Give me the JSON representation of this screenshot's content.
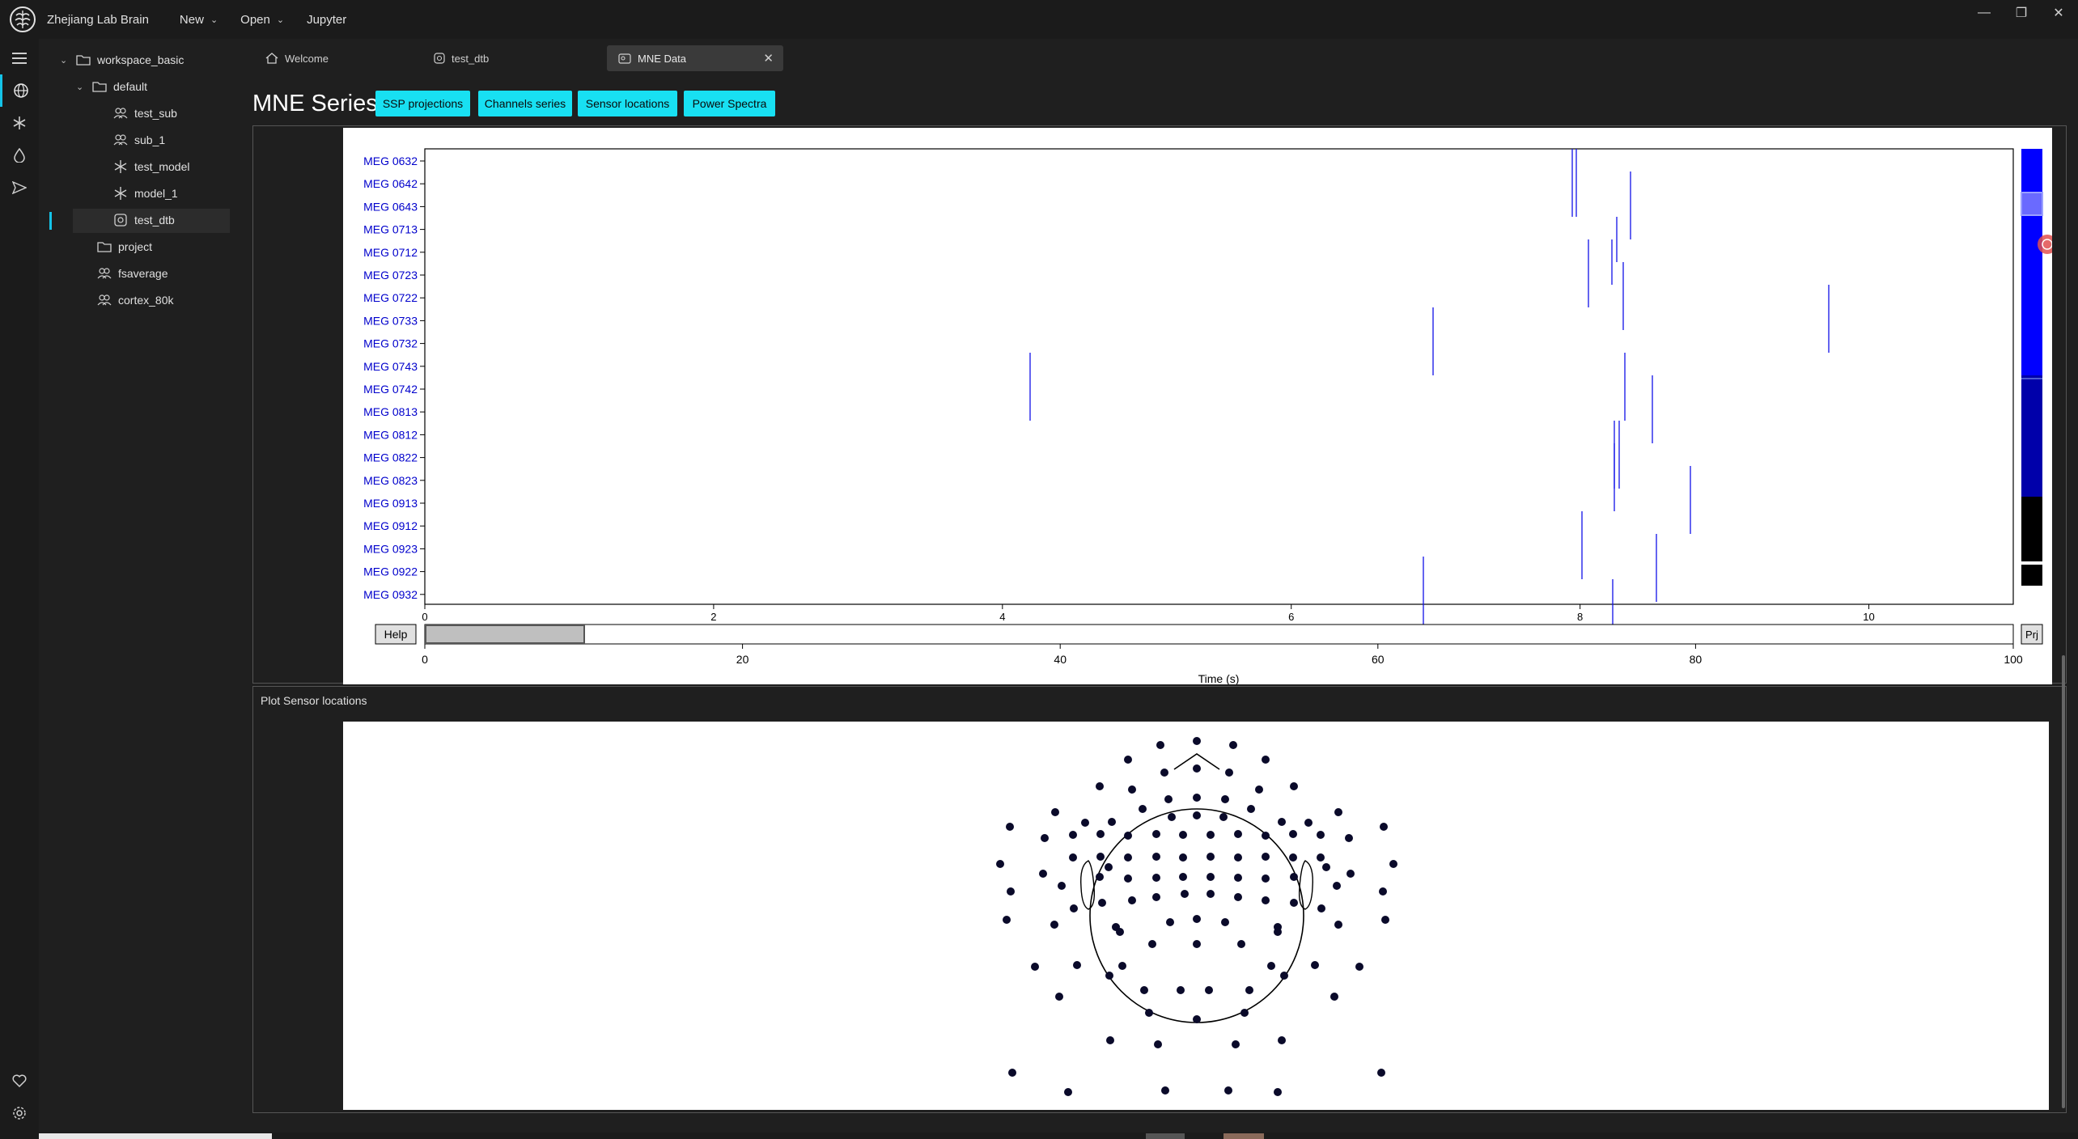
{
  "app": {
    "name": "Zhejiang Lab Brain"
  },
  "menu": {
    "new": "New",
    "open": "Open",
    "jupyter": "Jupyter"
  },
  "window_controls": {
    "minimize": "—",
    "restore": "❐",
    "close": "✕"
  },
  "activity_icons": [
    "menu-icon",
    "globe-icon",
    "asterisk-icon",
    "drop-icon",
    "send-icon",
    "heart-icon",
    "settings-icon"
  ],
  "tree": {
    "workspace": "workspace_basic",
    "default": "default",
    "test_sub": "test_sub",
    "sub_1": "sub_1",
    "test_model": "test_model",
    "model_1": "model_1",
    "test_dtb": "test_dtb",
    "project": "project",
    "fsaverage": "fsaverage",
    "cortex_80k": "cortex_80k"
  },
  "tabs": {
    "welcome": "Welcome",
    "test_dtb": "test_dtb",
    "mne_data": "MNE Data",
    "close": "✕"
  },
  "main": {
    "title": "MNE Series",
    "buttons": {
      "ssp": "SSP projections",
      "channels": "Channels series",
      "sensors": "Sensor locations",
      "spectra": "Power Spectra"
    },
    "sensor_plot_label": "Plot Sensor locations"
  },
  "timeseries": {
    "channels": [
      "MEG 0632",
      "MEG 0642",
      "MEG 0643",
      "MEG 0713",
      "MEG 0712",
      "MEG 0723",
      "MEG 0722",
      "MEG 0733",
      "MEG 0732",
      "MEG 0743",
      "MEG 0742",
      "MEG 0813",
      "MEG 0812",
      "MEG 0822",
      "MEG 0823",
      "MEG 0913",
      "MEG 0912",
      "MEG 0923",
      "MEG 0922",
      "MEG 0932"
    ],
    "xaxis_ticks": [
      "0",
      "2",
      "4",
      "6",
      "8",
      "10"
    ],
    "scroll_ticks": [
      "0",
      "20",
      "40",
      "60",
      "80",
      "100"
    ],
    "xlabel": "Time (s)",
    "help_label": "Help",
    "proj_label": "Prj",
    "trace_color": "#1010e8",
    "label_color": "#0000cc"
  },
  "colors": {
    "accent": "#14c3e8",
    "button": "#18e0f2"
  }
}
